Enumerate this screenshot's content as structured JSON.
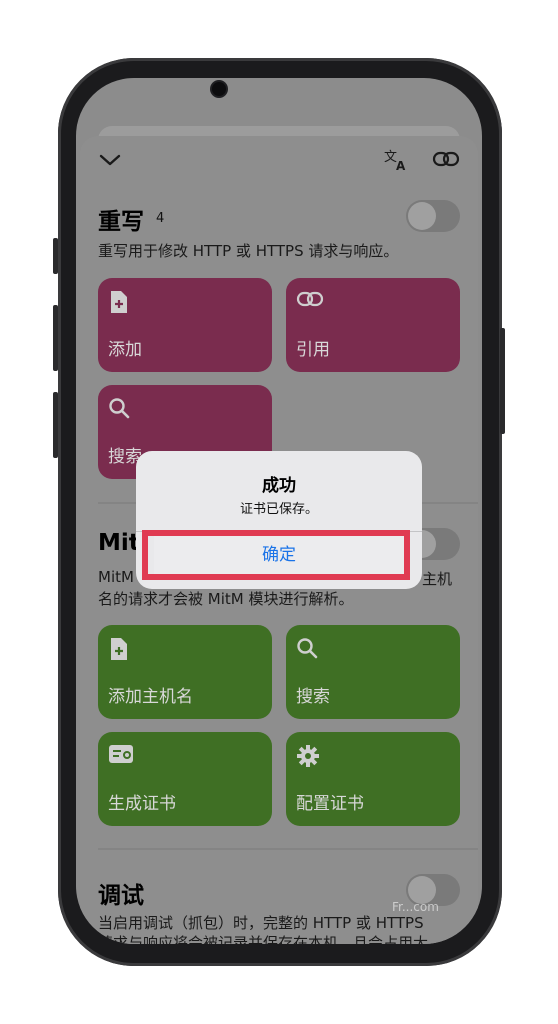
{
  "toolbar": {
    "collapse_icon": "chevron-down-icon",
    "translate_icon": "translate-icon",
    "link_icon": "link-icon"
  },
  "rewrite": {
    "title": "重写",
    "count": "4",
    "description": "重写用于修改 HTTP 或 HTTPS 请求与响应。",
    "enabled": false,
    "tiles": [
      {
        "label": "添加",
        "icon": "add-file-icon"
      },
      {
        "label": "引用",
        "icon": "link-icon"
      },
      {
        "label": "搜索",
        "icon": "search-icon"
      }
    ]
  },
  "mitm": {
    "title": "MitM",
    "description_line1": "MitM",
    "description_line1_tail": "主机",
    "description_line2": "名的请求才会被 MitM 模块进行解析。",
    "enabled": false,
    "tiles": [
      {
        "label": "添加主机名",
        "icon": "add-file-icon"
      },
      {
        "label": "搜索",
        "icon": "search-icon"
      },
      {
        "label": "生成证书",
        "icon": "certificate-icon"
      },
      {
        "label": "配置证书",
        "icon": "gear-icon"
      }
    ]
  },
  "debug": {
    "title": "调试",
    "description_line1": "当启用调试（抓包）时，完整的 HTTP 或 HTTPS",
    "description_line2": "请求与响应将会被记录并保存在本机，且会占用大",
    "enabled": false
  },
  "dialog": {
    "title": "成功",
    "message": "证书已保存。",
    "confirm_label": "确定"
  },
  "watermark": "Fr...com",
  "colors": {
    "accent": "#1a73e8",
    "highlight": "#e03b52",
    "pink_tile": "#7a2c4e",
    "green_tile": "#3f6f24"
  }
}
